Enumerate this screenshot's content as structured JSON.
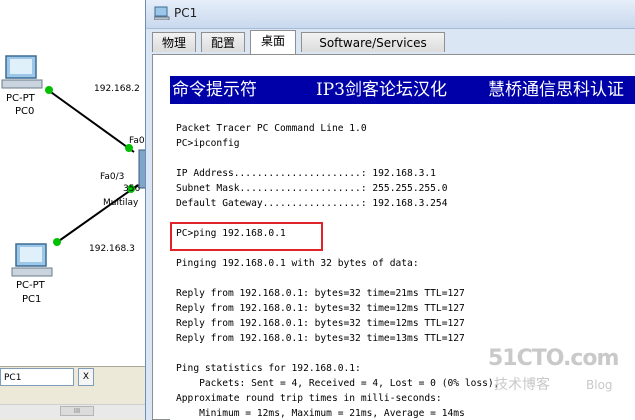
{
  "topology": {
    "devices": [
      {
        "type": "PC-PT",
        "name": "PC0"
      },
      {
        "type": "PC-PT",
        "name": "PC1"
      }
    ],
    "switch": {
      "model_partial": "356",
      "type_partial": "Multilay"
    },
    "link_labels": {
      "pc0_ip_partial": "192.168.2",
      "pc1_ip_partial": "192.168.3",
      "switch_port_top": "Fa0",
      "switch_port_left": "Fa0/3"
    },
    "bottom": {
      "tab_label": "PC1",
      "close_label": "X",
      "scroll_thumb": "III"
    }
  },
  "window": {
    "title": "PC1",
    "tabs": [
      {
        "label": "物理",
        "active": false
      },
      {
        "label": "配置",
        "active": false
      },
      {
        "label": "桌面",
        "active": true
      },
      {
        "label": "Software/Services",
        "active": false
      }
    ]
  },
  "command_prompt": {
    "header": {
      "title": "命令提示符",
      "credit1": "IP3剑客论坛汉化",
      "credit2": "慧桥通信思科认证"
    },
    "lines": [
      "Packet Tracer PC Command Line 1.0",
      "PC>ipconfig",
      "",
      "IP Address......................: 192.168.3.1",
      "Subnet Mask.....................: 255.255.255.0",
      "Default Gateway.................: 192.168.3.254",
      "",
      "PC>ping 192.168.0.1",
      "",
      "Pinging 192.168.0.1 with 32 bytes of data:",
      "",
      "Reply from 192.168.0.1: bytes=32 time=21ms TTL=127",
      "Reply from 192.168.0.1: bytes=32 time=12ms TTL=127",
      "Reply from 192.168.0.1: bytes=32 time=12ms TTL=127",
      "Reply from 192.168.0.1: bytes=32 time=13ms TTL=127",
      "",
      "Ping statistics for 192.168.0.1:",
      "    Packets: Sent = 4, Received = 4, Lost = 0 (0% loss),",
      "Approximate round trip times in milli-seconds:",
      "    Minimum = 12ms, Maximum = 21ms, Average = 14ms"
    ]
  },
  "watermark": {
    "main": "51CTO.com",
    "sub": "技术博客",
    "blog": "Blog"
  },
  "colors": {
    "cmd_header_bg": "#0000a8",
    "highlight_box": "#e0242a",
    "link_line": "#000000",
    "link_up": "#00c000"
  }
}
